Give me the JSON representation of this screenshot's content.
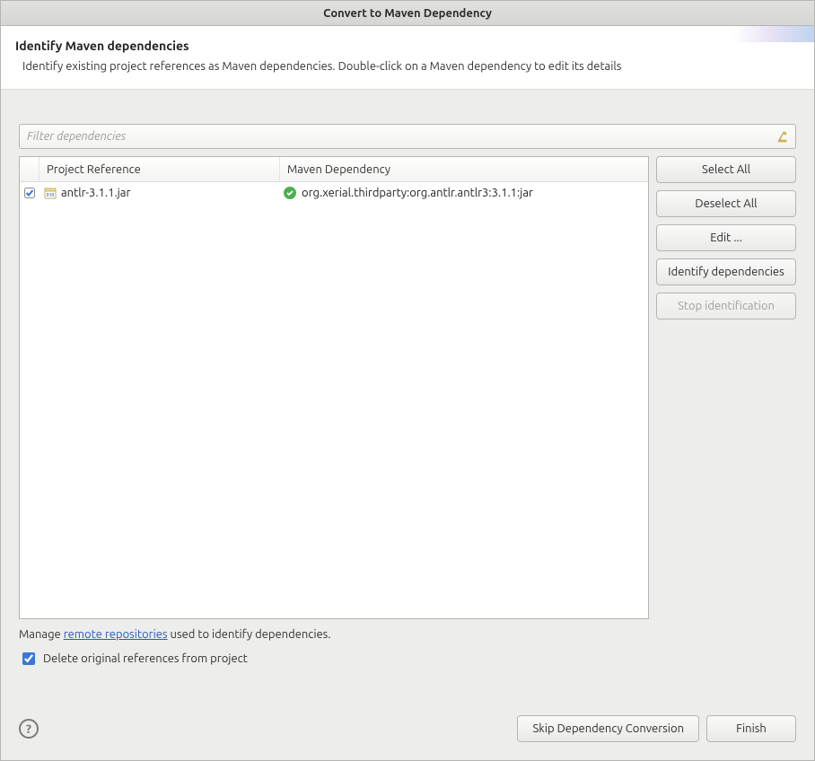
{
  "window": {
    "title": "Convert to Maven Dependency"
  },
  "header": {
    "title": "Identify Maven dependencies",
    "description": "Identify existing project references as Maven dependencies. Double-click on a Maven dependency to edit its details"
  },
  "filter": {
    "placeholder": "Filter dependencies"
  },
  "table": {
    "columns": {
      "reference": "Project Reference",
      "dependency": "Maven Dependency"
    },
    "rows": [
      {
        "checked": true,
        "reference": "antlr-3.1.1.jar",
        "dependency": "org.xerial.thirdparty:org.antlr.antlr3:3.1.1:jar"
      }
    ]
  },
  "sideButtons": {
    "selectAll": "Select All",
    "deselectAll": "Deselect All",
    "edit": "Edit ...",
    "identify": "Identify dependencies",
    "stop": "Stop identification"
  },
  "below": {
    "manage_prefix": "Manage ",
    "manage_link": "remote repositories",
    "manage_suffix": " used to identify dependencies."
  },
  "deleteOriginal": {
    "label": "Delete original references from project",
    "checked": true
  },
  "footer": {
    "skip": "Skip Dependency Conversion",
    "finish": "Finish"
  }
}
